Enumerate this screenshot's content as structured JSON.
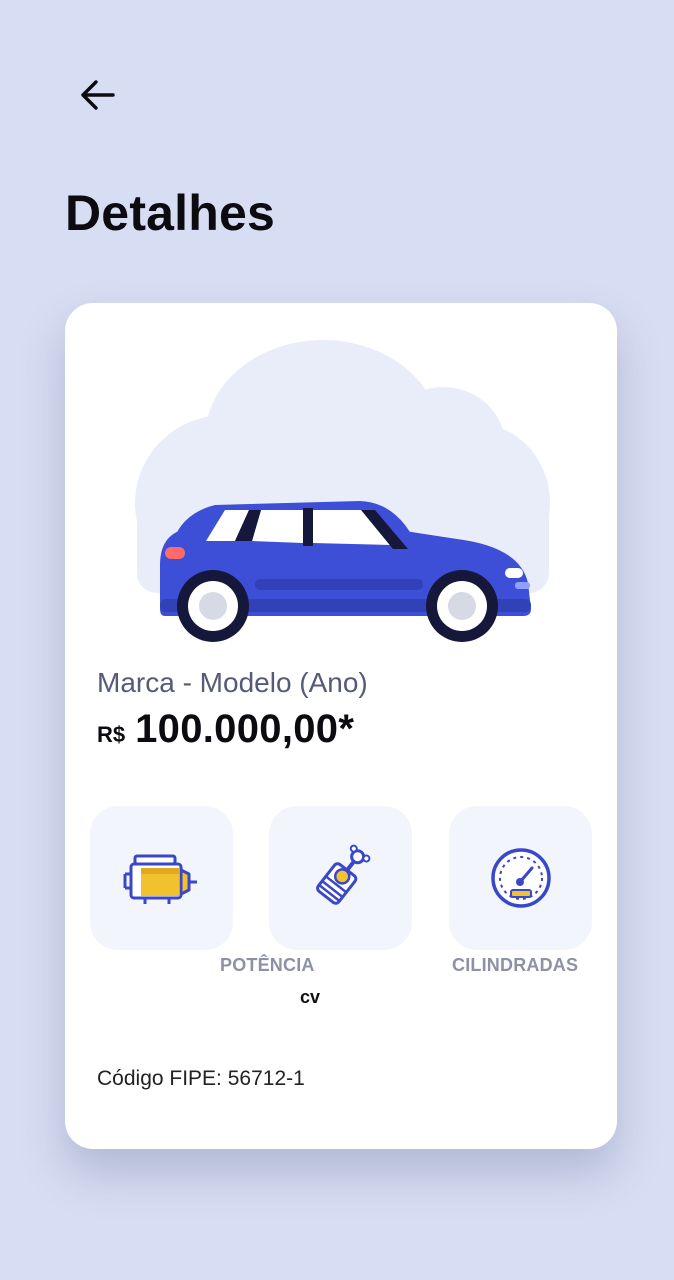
{
  "header": {
    "title": "Detalhes",
    "back_icon": "arrow-left-icon"
  },
  "vehicle": {
    "title": "Marca - Modelo (Ano)",
    "currency": "R$",
    "price": "100.000,00*",
    "fipe_code": "Código FIPE: 56712-1",
    "image_icon": "car-icon"
  },
  "specs": [
    {
      "icon": "engine-icon",
      "label": "",
      "value": ""
    },
    {
      "icon": "piston-icon",
      "label": "POTÊNCIA",
      "value": "cv"
    },
    {
      "icon": "speedometer-icon",
      "label": "CILINDRADAS",
      "value": ""
    }
  ],
  "colors": {
    "background": "#d7ddf2",
    "car_body": "#3d4fd6",
    "accent_yellow": "#f2c12e",
    "icon_blue": "#3947c9"
  }
}
